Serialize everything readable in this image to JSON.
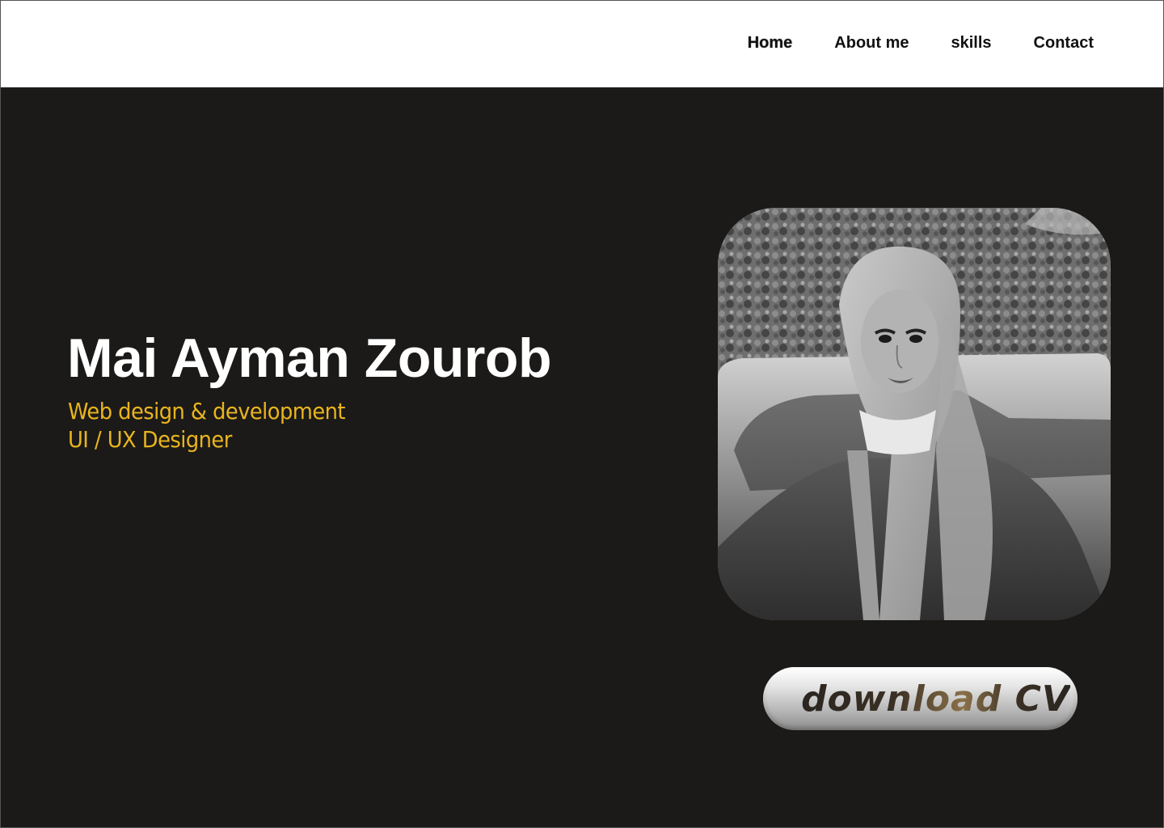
{
  "nav": {
    "items": [
      {
        "label": "Home",
        "active": true
      },
      {
        "label": "About me"
      },
      {
        "label": "skills"
      },
      {
        "label": "Contact"
      }
    ]
  },
  "hero": {
    "name": "Mai Ayman Zourob",
    "subtitle_line1": "Web design & development",
    "subtitle_line2": "UI / UX Designer"
  },
  "photo": {
    "alt": "portrait photo"
  },
  "cv_button": {
    "label": "download CV"
  },
  "colors": {
    "background": "#1b1a18",
    "header": "#ffffff",
    "name": "#ffffff",
    "accent": "#e9b41e"
  }
}
